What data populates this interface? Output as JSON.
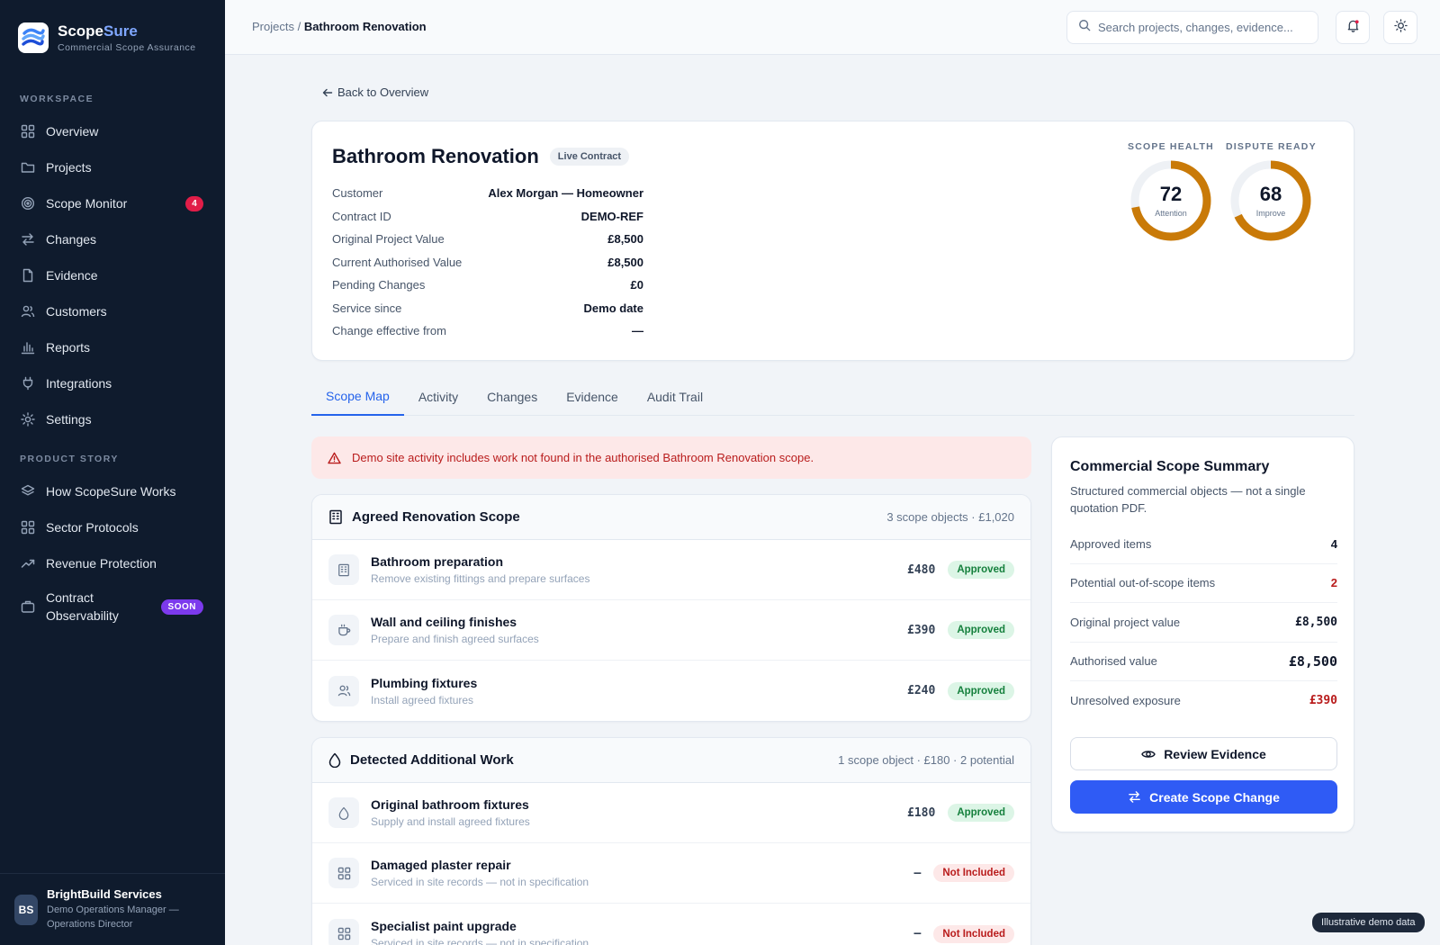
{
  "brand": {
    "name_primary": "Scope",
    "name_accent": "Sure",
    "subtitle": "Commercial Scope Assurance"
  },
  "sidebar": {
    "workspace_label": "WORKSPACE",
    "workspace_items": [
      {
        "label": "Overview",
        "icon": "grid-icon"
      },
      {
        "label": "Projects",
        "icon": "folder-icon"
      },
      {
        "label": "Scope Monitor",
        "icon": "target-icon",
        "badge": "4"
      },
      {
        "label": "Changes",
        "icon": "swap-icon"
      },
      {
        "label": "Evidence",
        "icon": "file-icon"
      },
      {
        "label": "Customers",
        "icon": "users-icon"
      },
      {
        "label": "Reports",
        "icon": "bar-chart-icon"
      },
      {
        "label": "Integrations",
        "icon": "plug-icon"
      },
      {
        "label": "Settings",
        "icon": "gear-icon"
      }
    ],
    "story_label": "PRODUCT STORY",
    "story_items": [
      {
        "label": "How ScopeSure Works",
        "icon": "layers-icon"
      },
      {
        "label": "Sector Protocols",
        "icon": "grid-icon"
      },
      {
        "label": "Revenue Protection",
        "icon": "trend-icon"
      },
      {
        "label_line1": "Contract",
        "label_line2": "Observability",
        "icon": "briefcase-icon",
        "badge": "SOON"
      }
    ],
    "footer": {
      "initials": "BS",
      "company": "BrightBuild Services",
      "role_line1": "Demo Operations Manager —",
      "role_line2": "Operations Director"
    }
  },
  "topbar": {
    "breadcrumb_parent": "Projects",
    "breadcrumb_sep": " / ",
    "breadcrumb_current": "Bathroom Renovation",
    "search_placeholder": "Search projects, changes, evidence..."
  },
  "back_link": "Back to Overview",
  "project": {
    "title": "Bathroom Renovation",
    "status": "Live Contract",
    "meta": [
      {
        "label": "Customer",
        "value": "Alex Morgan — Homeowner"
      },
      {
        "label": "Contract ID",
        "value": "DEMO-REF"
      },
      {
        "label": "Original Project Value",
        "value": "£8,500"
      },
      {
        "label": "Current Authorised Value",
        "value": "£8,500"
      },
      {
        "label": "Pending Changes",
        "value": "£0"
      },
      {
        "label": "Service since",
        "value": "Demo date"
      },
      {
        "label": "Change effective from",
        "value": "—"
      }
    ],
    "gauges": [
      {
        "label": "SCOPE HEALTH",
        "value": "72",
        "caption": "Attention",
        "percent": 72
      },
      {
        "label": "DISPUTE READY",
        "value": "68",
        "caption": "Improve",
        "percent": 68
      }
    ],
    "gauge_color": "#c97a08"
  },
  "tabs": [
    "Scope Map",
    "Activity",
    "Changes",
    "Evidence",
    "Audit Trail"
  ],
  "alert": "Demo site activity includes work not found in the authorised Bathroom Renovation scope.",
  "agreed": {
    "title": "Agreed Renovation Scope",
    "summary": "3 scope objects · £1,020",
    "rows": [
      {
        "title": "Bathroom preparation",
        "sub": "Remove existing fittings and prepare surfaces",
        "price": "£480",
        "status": "Approved",
        "icon": "building-icon"
      },
      {
        "title": "Wall and ceiling finishes",
        "sub": "Prepare and finish agreed surfaces",
        "price": "£390",
        "status": "Approved",
        "icon": "cup-icon"
      },
      {
        "title": "Plumbing fixtures",
        "sub": "Install agreed fixtures",
        "price": "£240",
        "status": "Approved",
        "icon": "users-icon"
      }
    ]
  },
  "detected": {
    "title": "Detected Additional Work",
    "summary": "1 scope object · £180 · 2 potential",
    "rows": [
      {
        "title": "Original bathroom fixtures",
        "sub": "Supply and install agreed fixtures",
        "price": "£180",
        "status": "Approved",
        "icon": "drop-icon"
      },
      {
        "title": "Damaged plaster repair",
        "sub": "Serviced in site records — not in specification",
        "price": "—",
        "status": "Not Included",
        "icon": "grid-icon"
      },
      {
        "title": "Specialist paint upgrade",
        "sub": "Serviced in site records — not in specification",
        "price": "—",
        "status": "Not Included",
        "icon": "grid-icon"
      }
    ]
  },
  "summary": {
    "title": "Commercial Scope Summary",
    "description": "Structured commercial objects — not a single quotation PDF.",
    "rows": [
      {
        "label": "Approved items",
        "value": "4"
      },
      {
        "label": "Potential out-of-scope items",
        "value": "2"
      },
      {
        "label": "Original project value",
        "value": "£8,500"
      },
      {
        "label": "Authorised value",
        "value": "£8,500"
      },
      {
        "label": "Unresolved exposure",
        "value": "£390"
      }
    ],
    "review_button": "Review Evidence",
    "create_button": "Create Scope Change"
  },
  "demo_tag": "Illustrative demo data",
  "colors": {
    "sidebar_bg": "#0f1b2d",
    "primary": "#2f5bf5",
    "danger": "#b91c1c",
    "success": "#15803d"
  }
}
